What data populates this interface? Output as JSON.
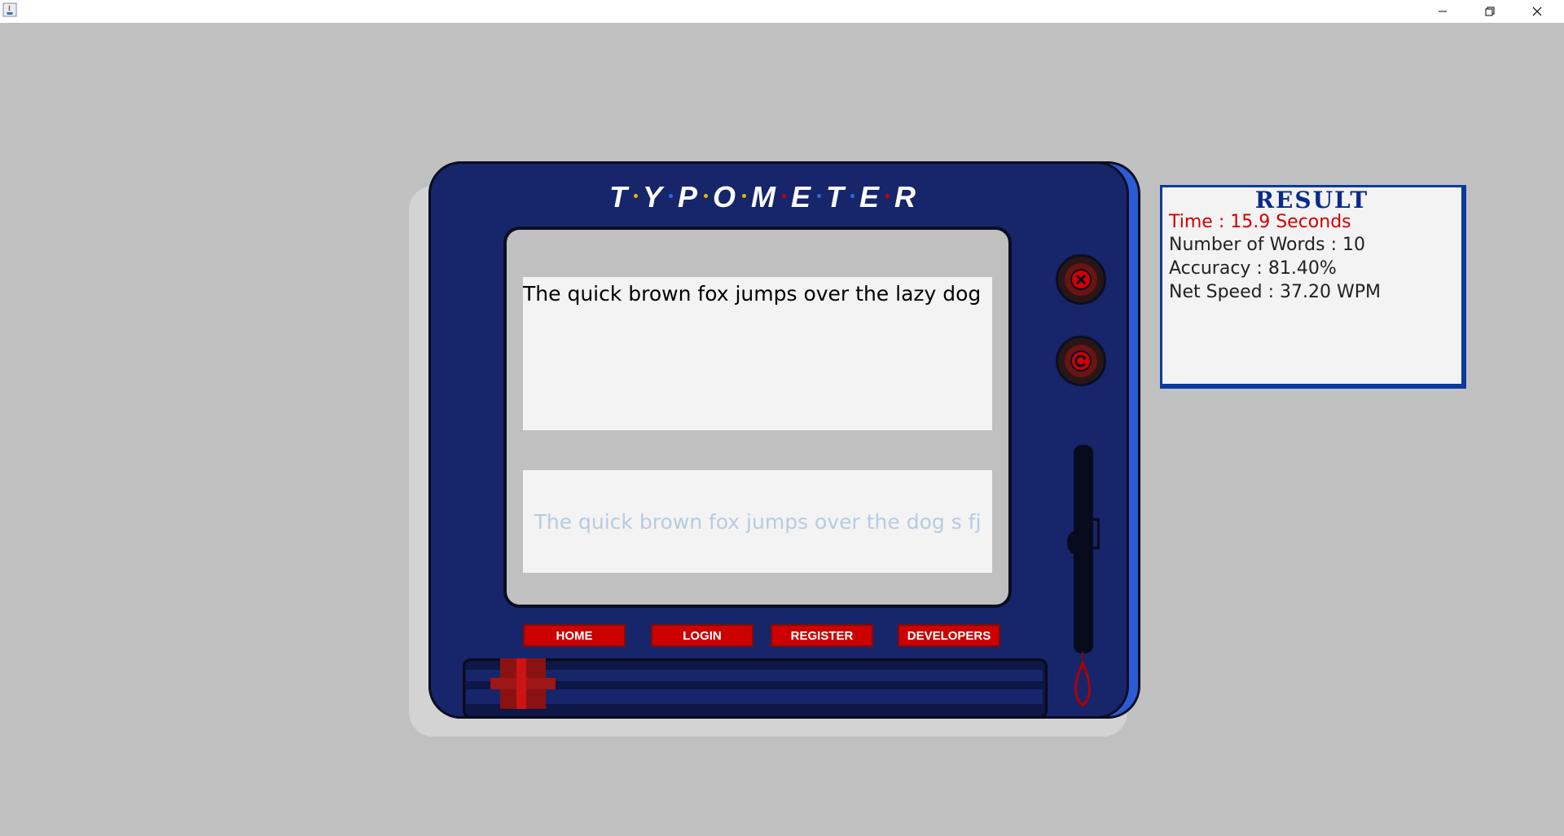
{
  "window": {
    "app_icon": "java-icon",
    "controls": {
      "minimize": "minimize-icon",
      "maximize": "restore-icon",
      "close": "close-icon"
    }
  },
  "logo": {
    "letters": [
      "T",
      "Y",
      "P",
      "O",
      "M",
      "E",
      "T",
      "E",
      "R"
    ],
    "dot_colors": [
      "#e8b400",
      "#2a6be0",
      "#e8b400",
      "#e8b400",
      "#d10000",
      "#2a6be0",
      "#2a6be0",
      "#d10000"
    ]
  },
  "typing": {
    "target_text": "The quick brown fox jumps over the lazy dog",
    "typed_text": "The quick brown fox jumps over the dog s fj"
  },
  "nav": {
    "home": "HOME",
    "login": "LOGIN",
    "register": "REGISTER",
    "developers": "DEVELOPERS"
  },
  "controls": {
    "close_icon": "close-icon",
    "reset_icon": "refresh-icon"
  },
  "result": {
    "title": "RESULT",
    "time": "Time : 15.9 Seconds",
    "words": "Number of Words : 10",
    "accuracy": "Accuracy : 81.40%",
    "speed": "Net Speed : 37.20 WPM"
  },
  "colors": {
    "device_body": "#17256a",
    "nav_button": "#cc0000",
    "result_border": "#0a3aa0",
    "time_text": "#d10000"
  }
}
